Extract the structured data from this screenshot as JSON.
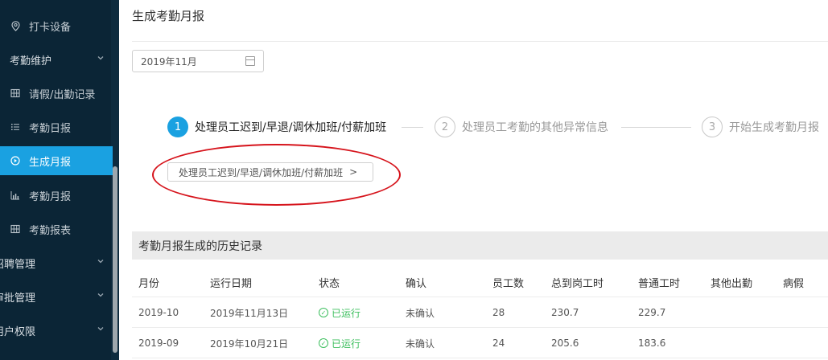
{
  "sidebar": {
    "items": [
      {
        "label": "打卡设备",
        "icon": "location-pin-icon"
      },
      {
        "label": "考勤维护",
        "icon": ""
      },
      {
        "label": "请假/出勤记录",
        "icon": "grid-icon"
      },
      {
        "label": "考勤日报",
        "icon": "list-icon"
      },
      {
        "label": "生成月报",
        "icon": "play-circle-icon"
      },
      {
        "label": "考勤月报",
        "icon": "bar-chart-icon"
      },
      {
        "label": "考勤报表",
        "icon": "grid-icon"
      },
      {
        "label": "招聘管理",
        "icon": ""
      },
      {
        "label": "审批管理",
        "icon": ""
      },
      {
        "label": "用户权限",
        "icon": ""
      }
    ]
  },
  "page": {
    "title": "生成考勤月报",
    "month_value": "2019年11月"
  },
  "steps": [
    {
      "num": "1",
      "label": "处理员工迟到/早退/调休加班/付薪加班"
    },
    {
      "num": "2",
      "label": "处理员工考勤的其他异常信息"
    },
    {
      "num": "3",
      "label": "开始生成考勤月报"
    }
  ],
  "action_button": {
    "label": "处理员工迟到/早退/调休加班/付薪加班",
    "arrow": ">"
  },
  "history": {
    "title": "考勤月报生成的历史记录",
    "columns": [
      "月份",
      "运行日期",
      "状态",
      "确认",
      "员工数",
      "总到岗工时",
      "普通工时",
      "其他出勤",
      "病假"
    ],
    "rows": [
      [
        "2019-10",
        "2019年11月13日",
        "已运行",
        "未确认",
        "28",
        "230.7",
        "229.7",
        "",
        ""
      ],
      [
        "2019-09",
        "2019年10月21日",
        "已运行",
        "未确认",
        "24",
        "205.6",
        "183.6",
        "",
        ""
      ]
    ]
  },
  "colors": {
    "accent": "#1aa1e1",
    "sidebar_bg": "#0b2536",
    "status_ok": "#3dbf5e",
    "annotation": "#d6141c"
  }
}
